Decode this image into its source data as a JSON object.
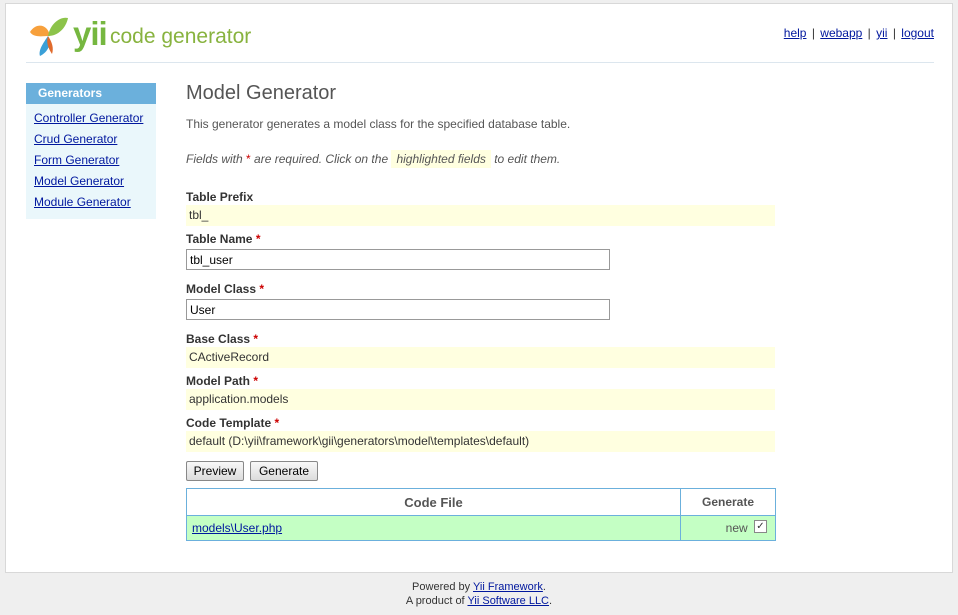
{
  "header": {
    "logo_yii": "yii",
    "logo_text": "code generator",
    "nav": [
      {
        "label": "help"
      },
      {
        "label": "webapp"
      },
      {
        "label": "yii"
      },
      {
        "label": "logout"
      }
    ],
    "nav_separator": "|"
  },
  "sidebar": {
    "title": "Generators",
    "items": [
      {
        "label": "Controller Generator"
      },
      {
        "label": "Crud Generator"
      },
      {
        "label": "Form Generator"
      },
      {
        "label": "Model Generator"
      },
      {
        "label": "Module Generator"
      }
    ]
  },
  "main": {
    "title": "Model Generator",
    "description": "This generator generates a model class for the specified database table.",
    "note_prefix": "Fields with",
    "note_star": "*",
    "note_middle": "are required. Click on the",
    "note_highlight": "highlighted fields",
    "note_suffix": "to edit them.",
    "required_mark": "*",
    "fields": {
      "table_prefix": {
        "label": "Table Prefix",
        "value": "tbl_"
      },
      "table_name": {
        "label": "Table Name",
        "value": "tbl_user"
      },
      "model_class": {
        "label": "Model Class",
        "value": "User"
      },
      "base_class": {
        "label": "Base Class",
        "value": "CActiveRecord"
      },
      "model_path": {
        "label": "Model Path",
        "value": "application.models"
      },
      "code_template": {
        "label": "Code Template",
        "value": "default (D:\\yii\\framework\\gii\\generators\\model\\templates\\default)"
      }
    },
    "buttons": {
      "preview": "Preview",
      "generate": "Generate"
    },
    "table": {
      "headers": [
        "Code File",
        "Generate"
      ],
      "rows": [
        {
          "file": "models\\User.php",
          "status": "new",
          "checked": "✓"
        }
      ]
    }
  },
  "footer": {
    "line1_prefix": "Powered by",
    "line1_link": "Yii Framework",
    "line1_suffix": ".",
    "line2_prefix": "A product of",
    "line2_link": "Yii Software LLC",
    "line2_suffix": "."
  },
  "colors": {
    "sidebar_title_bg": "#6bb0dc",
    "sticky_bg": "#ffffe0",
    "table_row_bg": "#c4ffc4",
    "link": "#00179e"
  }
}
